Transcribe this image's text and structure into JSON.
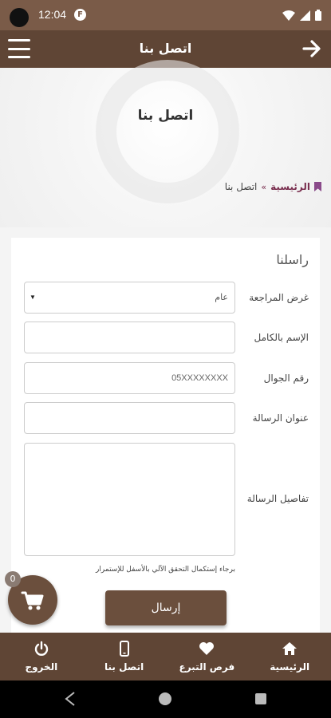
{
  "status_bar": {
    "time": "12:04",
    "notification_glyph": "F"
  },
  "app_bar": {
    "title": "اتصل بنا"
  },
  "hero": {
    "title": "اتصل بنا"
  },
  "breadcrumb": {
    "home": "الرئيسية",
    "separator": "»",
    "current": "اتصل بنا"
  },
  "form": {
    "title": "راسلنا",
    "purpose": {
      "label": "غرض المراجعة",
      "value": "عام"
    },
    "full_name": {
      "label": "الإسم بالكامل",
      "value": ""
    },
    "mobile": {
      "label": "رقم الجوال",
      "placeholder": "05XXXXXXXX"
    },
    "subject": {
      "label": "عنوان الرسالة",
      "value": ""
    },
    "details": {
      "label": "تفاصيل الرسالة",
      "value": ""
    },
    "captcha_note": "برجاء إستكمال التحقق الآلي بالأسفل للإستمرار",
    "submit_label": "إرسال"
  },
  "cart": {
    "count": "0"
  },
  "bottom_nav": [
    {
      "label": "الرئيسية",
      "icon": "home-icon"
    },
    {
      "label": "فرص التبرع",
      "icon": "heart-icon"
    },
    {
      "label": "اتصل بنا",
      "icon": "phone-icon"
    },
    {
      "label": "الخروج",
      "icon": "power-icon"
    }
  ],
  "colors": {
    "primary": "#5f4535",
    "status": "#7a5b48",
    "button": "#6b4f3d",
    "breadcrumb": "#7a2f4f"
  }
}
